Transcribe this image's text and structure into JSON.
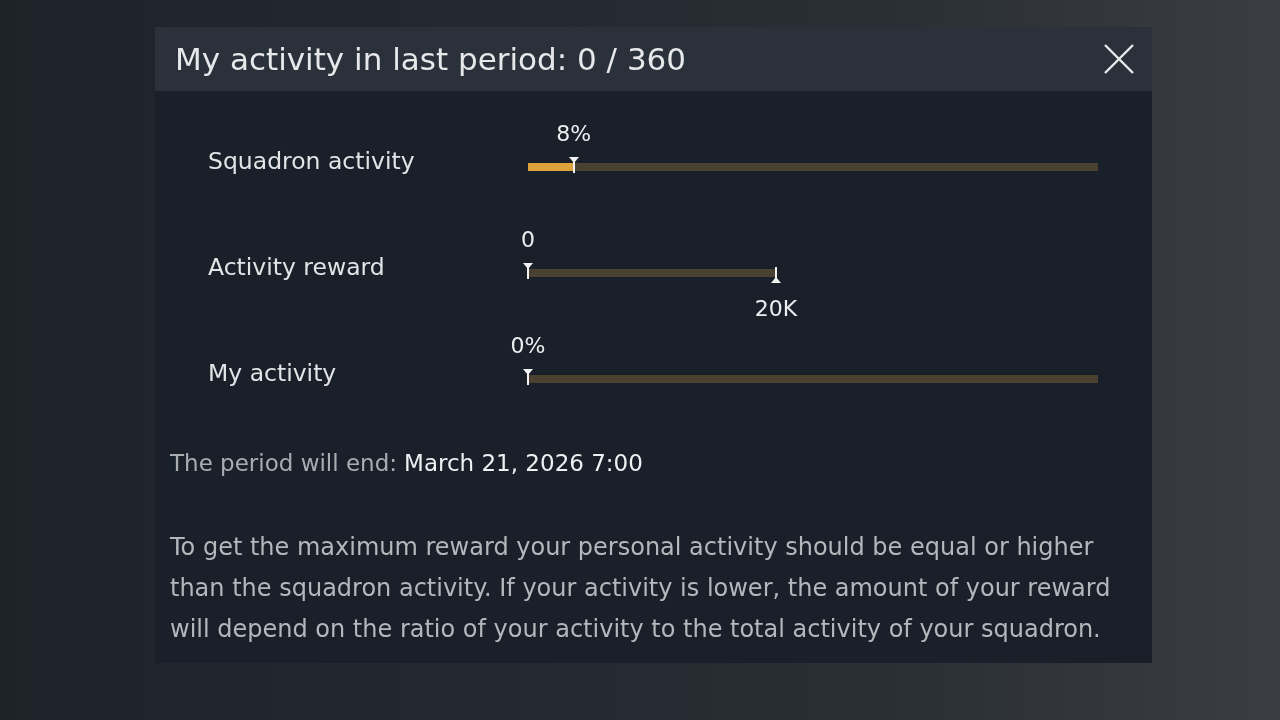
{
  "dialog": {
    "title": "My activity in last period: 0 / 360",
    "rows": [
      {
        "label": "Squadron activity",
        "kind": "meter",
        "level": 0.08,
        "reading": "8%"
      },
      {
        "label": "Activity reward",
        "kind": "range",
        "level": 0,
        "reading": "0",
        "end_label": "20K"
      },
      {
        "label": "My activity",
        "kind": "meter",
        "level": 0,
        "reading": "0%"
      }
    ],
    "period_end": {
      "label": "The period will end:",
      "value": "March 21, 2026 7:00"
    },
    "note": "To get the maximum reward your personal activity should be equal or higher than the squadron activity. If your activity is lower, the amount of your reward will depend on the ratio of your activity to the total activity of your squadron."
  }
}
